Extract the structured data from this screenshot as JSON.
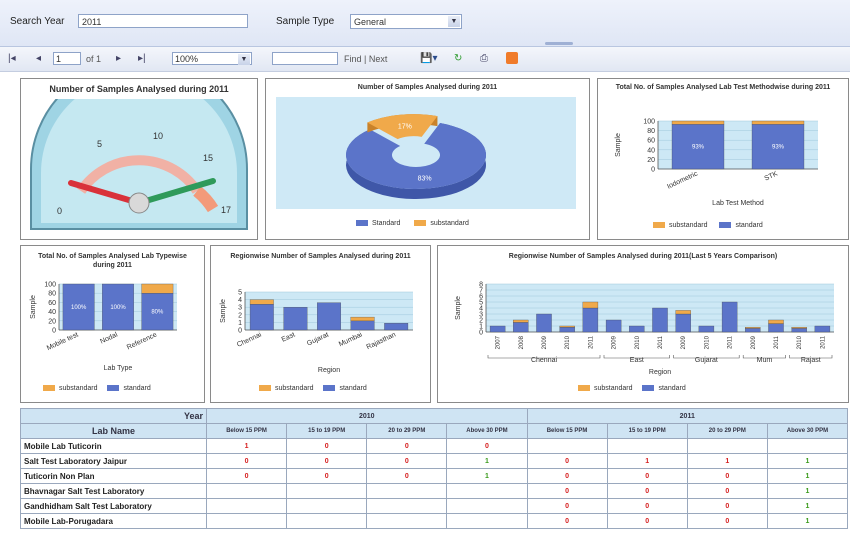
{
  "params": {
    "search_year_label": "Search Year",
    "search_year_value": "2011",
    "sample_type_label": "Sample Type",
    "sample_type_value": "General"
  },
  "toolbar": {
    "page_value": "1",
    "of_pages": "of 1",
    "zoom": "100%",
    "find_next": "Find | Next"
  },
  "gauge_panel": {
    "title": "Number of Samples Analysed during 2011",
    "tick_labels": [
      "0",
      "5",
      "10",
      "15",
      "17"
    ]
  },
  "donut_panel": {
    "title": "Number of Samples Analysed during 2011",
    "legend": [
      "Standard",
      "substandard"
    ],
    "chart_data": {
      "type": "pie",
      "categories": [
        "Standard",
        "substandard"
      ],
      "values": [
        83,
        17
      ],
      "value_labels": [
        "83%",
        "17%"
      ]
    }
  },
  "method_panel": {
    "title": "Total No. of Samples Analysed Lab Test Methodwise during 2011",
    "ylabel": "Sample",
    "xlabel": "Lab Test Method",
    "legend": [
      "substandard",
      "standard"
    ],
    "chart_data": {
      "type": "bar",
      "categories": [
        "Iodometric",
        "STK"
      ],
      "ylim": [
        0,
        100
      ],
      "yticks": [
        "0",
        "20",
        "40",
        "60",
        "80",
        "100"
      ],
      "series": [
        {
          "name": "standard",
          "values": [
            93,
            93
          ]
        },
        {
          "name": "substandard",
          "values": [
            7,
            7
          ]
        }
      ],
      "value_labels": [
        "93%",
        "93%"
      ]
    }
  },
  "labtype_panel": {
    "title": "Total No. of Samples Analysed Lab Typewise during 2011",
    "ylabel": "Sample",
    "xlabel": "Lab Type",
    "legend": [
      "substandard",
      "standard"
    ],
    "chart_data": {
      "type": "bar",
      "categories": [
        "Mobile test",
        "Nodal",
        "Reference"
      ],
      "ylim": [
        0,
        100
      ],
      "yticks": [
        "0",
        "20",
        "40",
        "60",
        "80",
        "100"
      ],
      "series": [
        {
          "name": "standard",
          "values": [
            100,
            100,
            80
          ]
        },
        {
          "name": "substandard",
          "values": [
            0,
            0,
            20
          ]
        }
      ],
      "value_labels": [
        "100%",
        "100%",
        "80%"
      ]
    }
  },
  "region_panel": {
    "title": "Regionwise Number of Samples Analysed during 2011",
    "ylabel": "Sample",
    "xlabel": "Region",
    "legend": [
      "substandard",
      "standard"
    ],
    "chart_data": {
      "type": "bar",
      "categories": [
        "Chennai",
        "East",
        "Gujarat",
        "Mumbai",
        "Rajasthan"
      ],
      "ylim": [
        0,
        5
      ],
      "yticks": [
        "0",
        "1",
        "2",
        "3",
        "4",
        "5"
      ],
      "series": [
        {
          "name": "standard",
          "values": [
            3.4,
            3,
            3.6,
            1.2,
            0.9
          ]
        },
        {
          "name": "substandard",
          "values": [
            0.6,
            0,
            0,
            0.5,
            0
          ]
        }
      ]
    }
  },
  "region5_panel": {
    "title": "Regionwise Number of Samples Analysed during 2011(Last 5 Years Comparison)",
    "ylabel": "Sample",
    "xlabel": "Region",
    "legend": [
      "substandard",
      "standard"
    ],
    "chart_data": {
      "type": "bar",
      "ylim": [
        0,
        8
      ],
      "yticks": [
        "0",
        "1",
        "2",
        "3",
        "4",
        "5",
        "6",
        "7",
        "8"
      ],
      "groups": [
        "Chennai",
        "East",
        "Gujarat",
        "Mum",
        "Rajast"
      ],
      "categories": [
        "2007",
        "2008",
        "2009",
        "2010",
        "2011",
        "2009",
        "2010",
        "2011",
        "2009",
        "2010",
        "2011",
        "2009",
        "2011",
        "2010",
        "2011"
      ],
      "series": [
        {
          "name": "standard",
          "values": [
            1,
            1.6,
            3,
            0.8,
            4,
            2,
            1,
            4,
            3,
            1,
            5,
            0.6,
            1.4,
            0.6,
            1
          ]
        },
        {
          "name": "substandard",
          "values": [
            0,
            0.4,
            0,
            0.2,
            1,
            0,
            0,
            0,
            0.6,
            0,
            0,
            0.2,
            0.6,
            0.2,
            0
          ]
        }
      ]
    }
  },
  "table": {
    "year_label": "Year",
    "lab_name_label": "Lab Name",
    "years": [
      "2010",
      "2011"
    ],
    "cols": [
      "Below 15 PPM",
      "15 to 19 PPM",
      "20 to 29 PPM",
      "Above 30 PPM",
      "Below 15 PPM",
      "15 to 19 PPM",
      "20 to 29 PPM",
      "Above 30 PPM"
    ],
    "rows": [
      {
        "name": "Mobile Lab Tuticorin",
        "cells": [
          "1",
          "0",
          "0",
          "0",
          "",
          "",
          "",
          ""
        ]
      },
      {
        "name": "Salt Test Laboratory Jaipur",
        "cells": [
          "0",
          "0",
          "0",
          "1",
          "0",
          "1",
          "1",
          "1"
        ]
      },
      {
        "name": "Tuticorin Non Plan",
        "cells": [
          "0",
          "0",
          "0",
          "1",
          "0",
          "0",
          "0",
          "1"
        ]
      },
      {
        "name": "Bhavnagar Salt Test Laboratory",
        "cells": [
          "",
          "",
          "",
          "",
          "0",
          "0",
          "0",
          "1"
        ]
      },
      {
        "name": "Gandhidham Salt Test Laboratory",
        "cells": [
          "",
          "",
          "",
          "",
          "0",
          "0",
          "0",
          "1"
        ]
      },
      {
        "name": "Mobile Lab-Porugadara",
        "cells": [
          "",
          "",
          "",
          "",
          "0",
          "0",
          "0",
          "1"
        ]
      }
    ]
  },
  "colors": {
    "standard": "#5b74c9",
    "substandard": "#f0a94a",
    "plot_bg": "#cde8f5",
    "red_value": "#d62020",
    "green_value": "#3a9a1a"
  }
}
